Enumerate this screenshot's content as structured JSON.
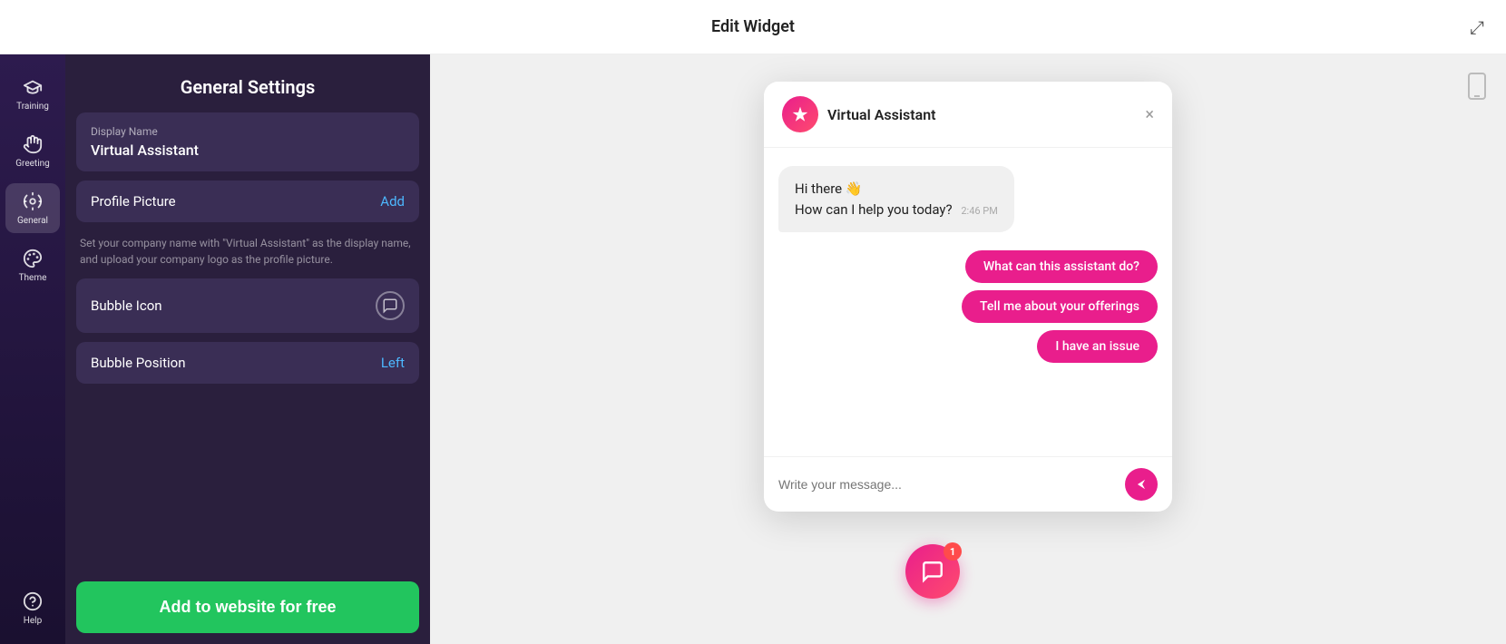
{
  "topbar": {
    "title": "Edit Widget",
    "expand_icon": "⤢"
  },
  "sidebar": {
    "items": [
      {
        "id": "training",
        "label": "Training",
        "icon": "🎓"
      },
      {
        "id": "greeting",
        "label": "Greeting",
        "icon": "✋"
      },
      {
        "id": "general",
        "label": "General",
        "icon": "⚙️",
        "active": true
      },
      {
        "id": "theme",
        "label": "Theme",
        "icon": "🎨"
      }
    ],
    "bottom_items": [
      {
        "id": "help",
        "label": "Help",
        "icon": "?"
      }
    ]
  },
  "settings": {
    "header": "General Settings",
    "display_name_label": "Display Name",
    "display_name_value": "Virtual Assistant",
    "profile_picture_label": "Profile Picture",
    "profile_picture_action": "Add",
    "hint_text": "Set your company name with \"Virtual Assistant\" as the display name, and upload your company logo as the profile picture.",
    "bubble_icon_label": "Bubble Icon",
    "bubble_position_label": "Bubble Position",
    "bubble_position_value": "Left",
    "add_button_label": "Add to website for free"
  },
  "chat_widget": {
    "title": "Virtual Assistant",
    "close_icon": "×",
    "avatar_icon": "✦",
    "bot_message_line1": "Hi there 👋",
    "bot_message_line2": "How can I help you today?",
    "bot_message_time": "2:46 PM",
    "suggestions": [
      "What can this assistant do?",
      "Tell me about your offerings",
      "I have an issue"
    ],
    "input_placeholder": "Write your message...",
    "send_icon": "▶",
    "bubble_badge": "1"
  }
}
